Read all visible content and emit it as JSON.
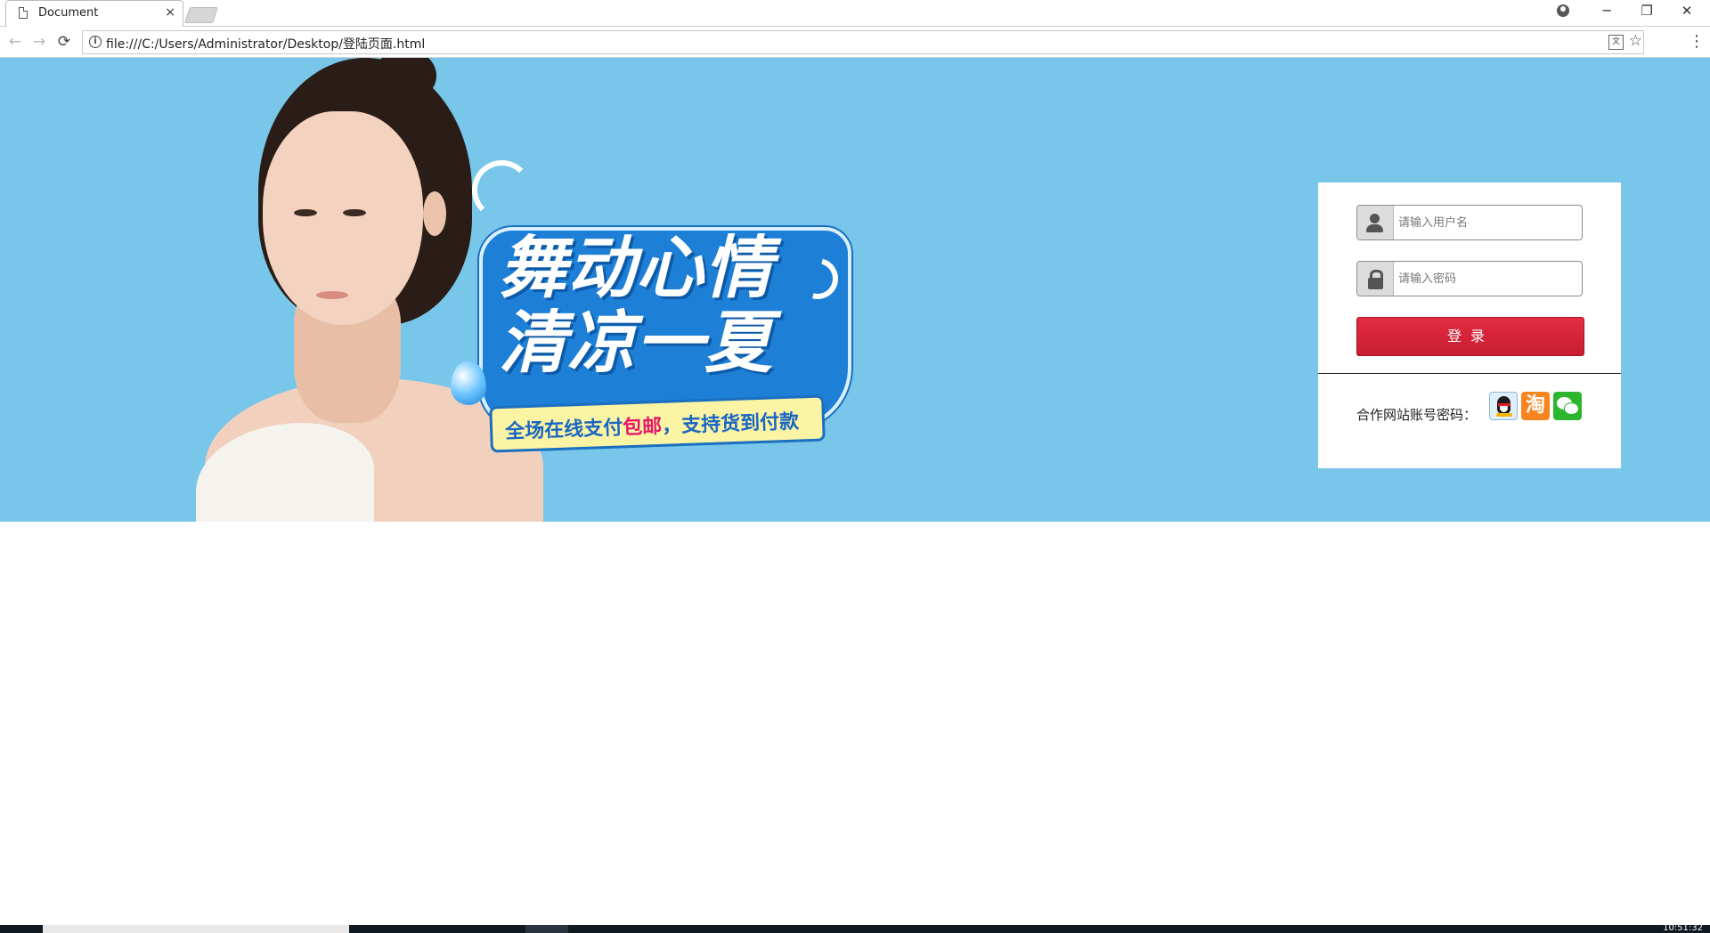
{
  "browser": {
    "tab_title": "Document",
    "tab_close": "×",
    "url": "file:///C:/Users/Administrator/Desktop/登陆页面.html",
    "nav_back": "←",
    "nav_forward": "→",
    "nav_reload": "⟳",
    "window_minimize": "─",
    "window_restore": "❐",
    "window_close": "✕",
    "menu": "⋮",
    "star": "☆",
    "translate": "文"
  },
  "banner": {
    "slogan_line1": "舞动心情",
    "slogan_line2": "清凉一夏",
    "ribbon_text_before": "全场在线支付",
    "ribbon_text_highlight": "包邮",
    "ribbon_text_after": "，支持货到付款",
    "colors": {
      "background": "#78c6ea",
      "badge_blue": "#1d7fd6",
      "highlight": "#e6186a"
    }
  },
  "login": {
    "username_placeholder": "请输入用户名",
    "password_placeholder": "请输入密码",
    "login_button": "登录",
    "partner_label": "合作网站账号密码：",
    "partners": [
      "qq-icon",
      "taobao-icon",
      "wechat-icon"
    ],
    "taobao_glyph": "淘",
    "colors": {
      "button": "#d4243a"
    }
  },
  "taskbar": {
    "clock": "10:51:32"
  }
}
